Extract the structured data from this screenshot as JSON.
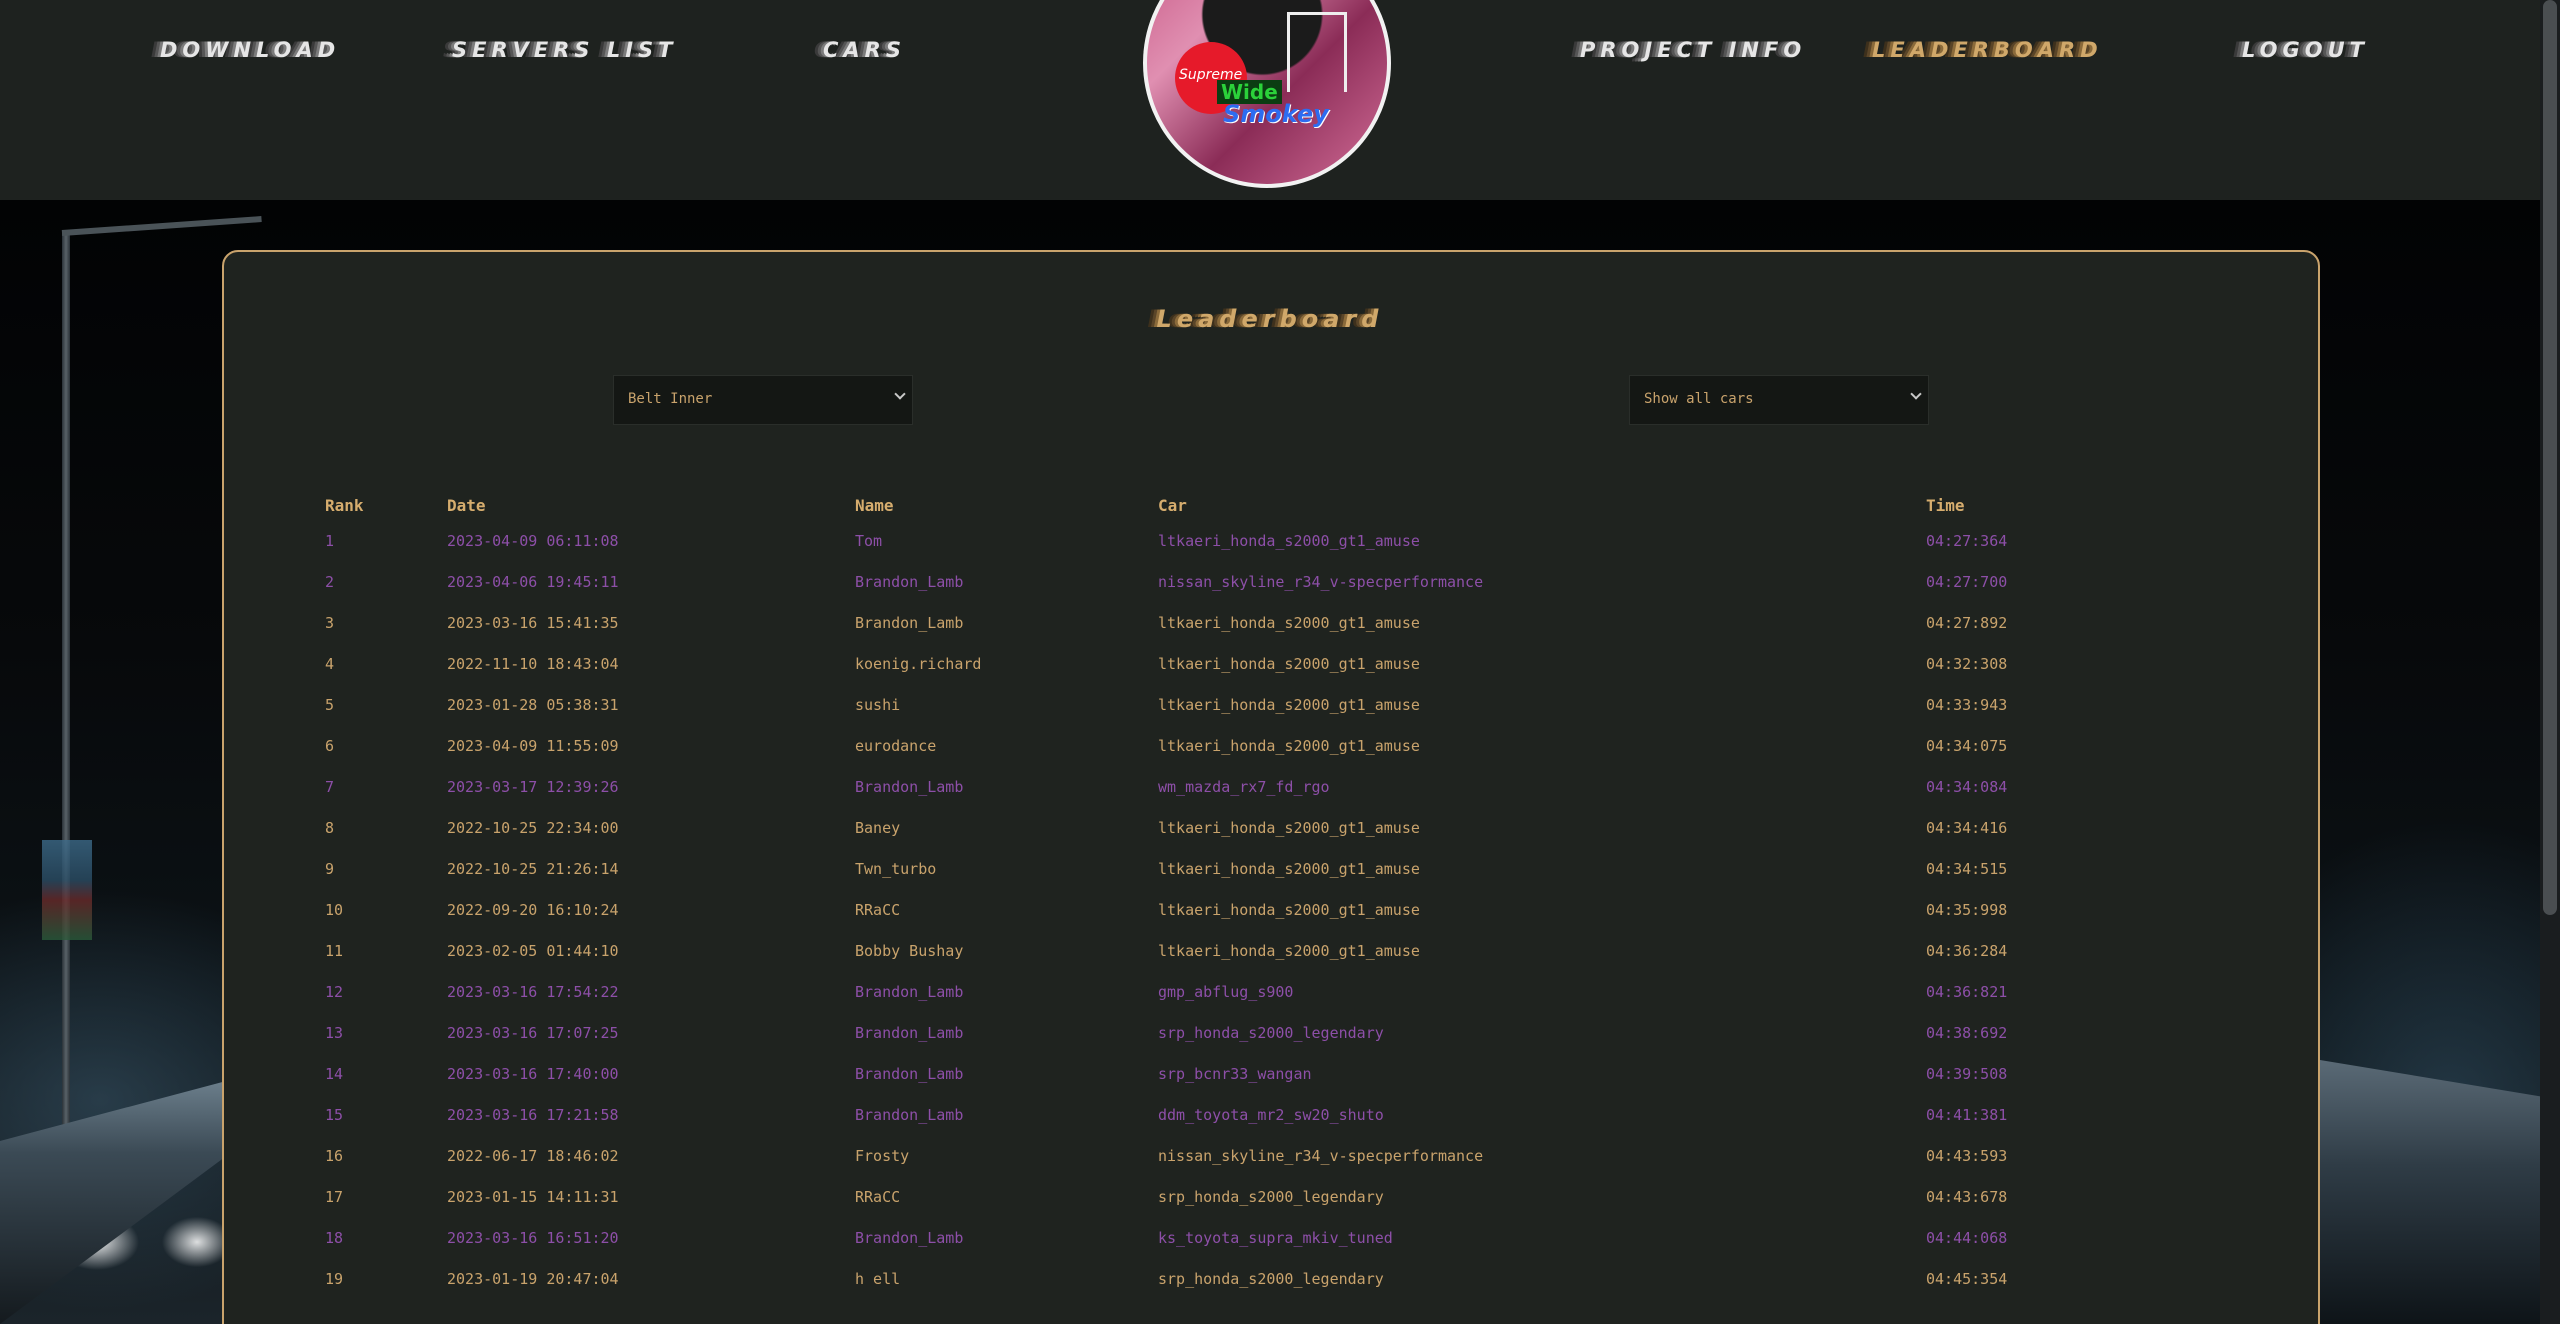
{
  "nav": {
    "download": "DOWNLOAD",
    "servers_list": "SERVERS LIST",
    "cars": "CARS",
    "project_info": "PROJECT INFO",
    "leaderboard": "LEADERBOARD",
    "logout": "LOGOUT"
  },
  "avatar": {
    "brand_text": "Supreme",
    "wide_text": "Wide",
    "name_text": "Smokey"
  },
  "page": {
    "title": "Leaderboard"
  },
  "filters": {
    "track_selected": "Belt Inner",
    "car_selected": "Show all cars"
  },
  "table": {
    "headers": [
      "Rank",
      "Date",
      "Name",
      "Car",
      "Time"
    ],
    "rows": [
      {
        "rank": "1",
        "date": "2023-04-09 06:11:08",
        "name": "Tom",
        "car": "ltkaeri_honda_s2000_gt1_amuse",
        "time": "04:27:364",
        "highlight": true
      },
      {
        "rank": "2",
        "date": "2023-04-06 19:45:11",
        "name": "Brandon_Lamb",
        "car": "nissan_skyline_r34_v-specperformance",
        "time": "04:27:700",
        "highlight": true
      },
      {
        "rank": "3",
        "date": "2023-03-16 15:41:35",
        "name": "Brandon_Lamb",
        "car": "ltkaeri_honda_s2000_gt1_amuse",
        "time": "04:27:892",
        "highlight": false
      },
      {
        "rank": "4",
        "date": "2022-11-10 18:43:04",
        "name": "koenig.richard",
        "car": "ltkaeri_honda_s2000_gt1_amuse",
        "time": "04:32:308",
        "highlight": false
      },
      {
        "rank": "5",
        "date": "2023-01-28 05:38:31",
        "name": "sushi",
        "car": "ltkaeri_honda_s2000_gt1_amuse",
        "time": "04:33:943",
        "highlight": false
      },
      {
        "rank": "6",
        "date": "2023-04-09 11:55:09",
        "name": "eurodance",
        "car": "ltkaeri_honda_s2000_gt1_amuse",
        "time": "04:34:075",
        "highlight": false
      },
      {
        "rank": "7",
        "date": "2023-03-17 12:39:26",
        "name": "Brandon_Lamb",
        "car": "wm_mazda_rx7_fd_rgo",
        "time": "04:34:084",
        "highlight": true
      },
      {
        "rank": "8",
        "date": "2022-10-25 22:34:00",
        "name": "Baney",
        "car": "ltkaeri_honda_s2000_gt1_amuse",
        "time": "04:34:416",
        "highlight": false
      },
      {
        "rank": "9",
        "date": "2022-10-25 21:26:14",
        "name": "Twn_turbo",
        "car": "ltkaeri_honda_s2000_gt1_amuse",
        "time": "04:34:515",
        "highlight": false
      },
      {
        "rank": "10",
        "date": "2022-09-20 16:10:24",
        "name": "RRaCC",
        "car": "ltkaeri_honda_s2000_gt1_amuse",
        "time": "04:35:998",
        "highlight": false
      },
      {
        "rank": "11",
        "date": "2023-02-05 01:44:10",
        "name": "Bobby Bushay",
        "car": "ltkaeri_honda_s2000_gt1_amuse",
        "time": "04:36:284",
        "highlight": false
      },
      {
        "rank": "12",
        "date": "2023-03-16 17:54:22",
        "name": "Brandon_Lamb",
        "car": "gmp_abflug_s900",
        "time": "04:36:821",
        "highlight": true
      },
      {
        "rank": "13",
        "date": "2023-03-16 17:07:25",
        "name": "Brandon_Lamb",
        "car": "srp_honda_s2000_legendary",
        "time": "04:38:692",
        "highlight": true
      },
      {
        "rank": "14",
        "date": "2023-03-16 17:40:00",
        "name": "Brandon_Lamb",
        "car": "srp_bcnr33_wangan",
        "time": "04:39:508",
        "highlight": true
      },
      {
        "rank": "15",
        "date": "2023-03-16 17:21:58",
        "name": "Brandon_Lamb",
        "car": "ddm_toyota_mr2_sw20_shuto",
        "time": "04:41:381",
        "highlight": true
      },
      {
        "rank": "16",
        "date": "2022-06-17 18:46:02",
        "name": "Frosty",
        "car": "nissan_skyline_r34_v-specperformance",
        "time": "04:43:593",
        "highlight": false
      },
      {
        "rank": "17",
        "date": "2023-01-15 14:11:31",
        "name": "RRaCC",
        "car": "srp_honda_s2000_legendary",
        "time": "04:43:678",
        "highlight": false
      },
      {
        "rank": "18",
        "date": "2023-03-16 16:51:20",
        "name": "Brandon_Lamb",
        "car": "ks_toyota_supra_mkiv_tuned",
        "time": "04:44:068",
        "highlight": true
      },
      {
        "rank": "19",
        "date": "2023-01-19 20:47:04",
        "name": "h ell",
        "car": "srp_honda_s2000_legendary",
        "time": "04:45:354",
        "highlight": false
      }
    ]
  },
  "colors": {
    "accent_gold": "#c9a36c",
    "highlight_purple": "#8d4fa8",
    "panel_bg": "#1f231f",
    "nav_bg": "#1e221f"
  }
}
